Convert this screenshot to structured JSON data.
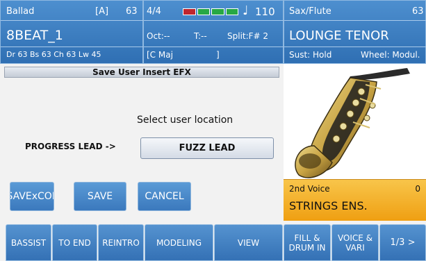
{
  "style_panel": {
    "style_name": "Ballad",
    "bank": "[A]",
    "style_number": "63",
    "variation": "8BEAT_1",
    "levels": "Dr 63  Bs 63  Ch 63  Lw 45"
  },
  "status_panel": {
    "time_signature": "4/4",
    "tempo": "110",
    "octave": "Oct:--",
    "transpose": "T:--",
    "split": "Split:F# 2",
    "chord": "[C Maj",
    "chord_end": "]",
    "beat_colors": [
      "#c0262e",
      "#27a845",
      "#27a845",
      "#27a845"
    ]
  },
  "voice_panel": {
    "category": "Sax/Flute",
    "number": "63",
    "voice_name": "LOUNGE TENOR",
    "sustain": "Sust: Hold",
    "wheel": "Wheel: Modul."
  },
  "dialog": {
    "title": "Save User Insert EFX",
    "prompt": "Select user location",
    "source_label": "PROGRESS LEAD ->",
    "destination_value": "FUZZ LEAD",
    "buttons": [
      "SAVExCOL",
      "SAVE",
      "CANCEL"
    ]
  },
  "second_voice": {
    "label": "2nd Voice",
    "number": "0",
    "name": "STRINGS ENS."
  },
  "function_buttons": [
    "BASSIST",
    "TO END",
    "REINTRO",
    "MODELING",
    "VIEW",
    "FILL &\nDRUM IN",
    "VOICE &\nVARI",
    "1/3 >"
  ],
  "colors": {
    "header_blue": "#3b7dc0",
    "second_voice_orange": "#f4b32a"
  }
}
